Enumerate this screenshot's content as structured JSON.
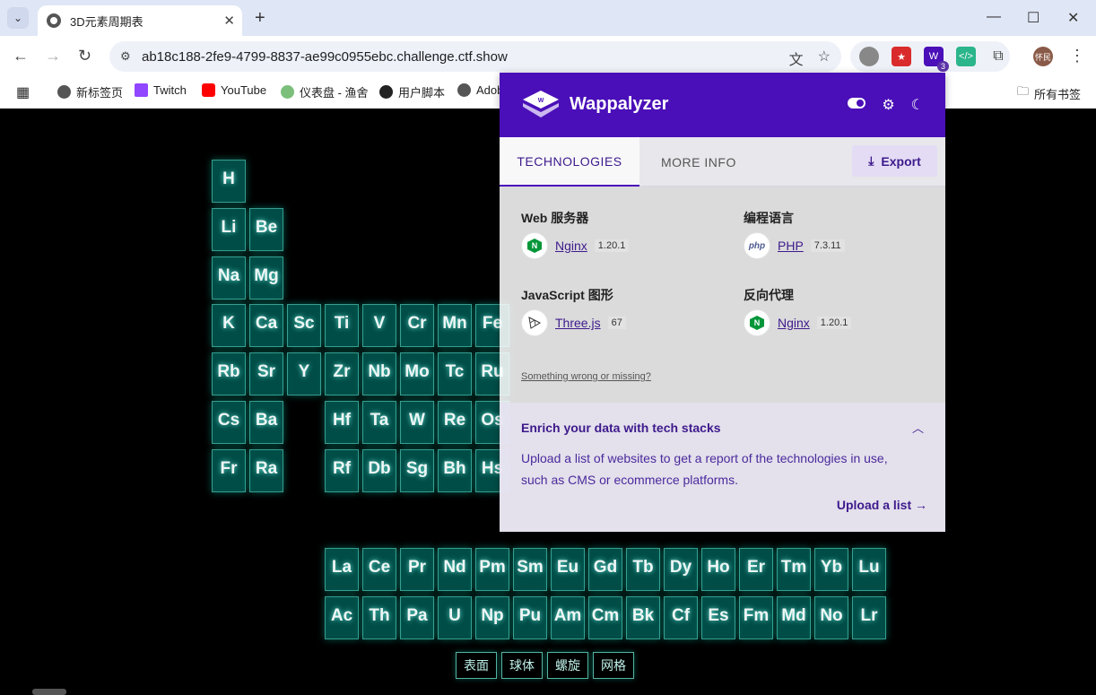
{
  "browser": {
    "tab_title": "3D元素周期表",
    "url": "ab18c188-2fe9-4799-8837-ae99c0955ebc.challenge.ctf.show",
    "ext_badge": "3",
    "avatar_text": "怀民"
  },
  "bookmarks": [
    {
      "label": "新标签页",
      "icon": "globe-icon",
      "color": "#555555"
    },
    {
      "label": "Twitch",
      "icon": "twitch-icon",
      "color": "#9146ff"
    },
    {
      "label": "YouTube",
      "icon": "youtube-icon",
      "color": "#ff0000"
    },
    {
      "label": "仪表盘 - 渔舍",
      "icon": "dashboard-icon",
      "color": "#7bbf7b"
    },
    {
      "label": "用户脚本",
      "icon": "script-icon",
      "color": "#222222"
    },
    {
      "label": "Adobe Ac...",
      "icon": "globe-icon",
      "color": "#555555"
    }
  ],
  "bookmarks_all": "所有书签",
  "table": {
    "elements": [
      {
        "s": "H",
        "r": 1,
        "c": 1
      },
      {
        "s": "Li",
        "r": 2,
        "c": 1
      },
      {
        "s": "Be",
        "r": 2,
        "c": 2
      },
      {
        "s": "Na",
        "r": 3,
        "c": 1
      },
      {
        "s": "Mg",
        "r": 3,
        "c": 2
      },
      {
        "s": "K",
        "r": 4,
        "c": 1
      },
      {
        "s": "Ca",
        "r": 4,
        "c": 2
      },
      {
        "s": "Sc",
        "r": 4,
        "c": 3
      },
      {
        "s": "Ti",
        "r": 4,
        "c": 4
      },
      {
        "s": "V",
        "r": 4,
        "c": 5
      },
      {
        "s": "Cr",
        "r": 4,
        "c": 6
      },
      {
        "s": "Mn",
        "r": 4,
        "c": 7
      },
      {
        "s": "Fe",
        "r": 4,
        "c": 8
      },
      {
        "s": "Rb",
        "r": 5,
        "c": 1
      },
      {
        "s": "Sr",
        "r": 5,
        "c": 2
      },
      {
        "s": "Y",
        "r": 5,
        "c": 3
      },
      {
        "s": "Zr",
        "r": 5,
        "c": 4
      },
      {
        "s": "Nb",
        "r": 5,
        "c": 5
      },
      {
        "s": "Mo",
        "r": 5,
        "c": 6
      },
      {
        "s": "Tc",
        "r": 5,
        "c": 7
      },
      {
        "s": "Ru",
        "r": 5,
        "c": 8
      },
      {
        "s": "Cs",
        "r": 6,
        "c": 1
      },
      {
        "s": "Ba",
        "r": 6,
        "c": 2
      },
      {
        "s": "Hf",
        "r": 6,
        "c": 4
      },
      {
        "s": "Ta",
        "r": 6,
        "c": 5
      },
      {
        "s": "W",
        "r": 6,
        "c": 6
      },
      {
        "s": "Re",
        "r": 6,
        "c": 7
      },
      {
        "s": "Os",
        "r": 6,
        "c": 8
      },
      {
        "s": "Fr",
        "r": 7,
        "c": 1
      },
      {
        "s": "Ra",
        "r": 7,
        "c": 2
      },
      {
        "s": "Rf",
        "r": 7,
        "c": 4
      },
      {
        "s": "Db",
        "r": 7,
        "c": 5
      },
      {
        "s": "Sg",
        "r": 7,
        "c": 6
      },
      {
        "s": "Bh",
        "r": 7,
        "c": 7
      },
      {
        "s": "Hs",
        "r": 7,
        "c": 8
      },
      {
        "s": "La",
        "r": 9,
        "c": 4
      },
      {
        "s": "Ce",
        "r": 9,
        "c": 5
      },
      {
        "s": "Pr",
        "r": 9,
        "c": 6
      },
      {
        "s": "Nd",
        "r": 9,
        "c": 7
      },
      {
        "s": "Pm",
        "r": 9,
        "c": 8
      },
      {
        "s": "Sm",
        "r": 9,
        "c": 9
      },
      {
        "s": "Eu",
        "r": 9,
        "c": 10
      },
      {
        "s": "Gd",
        "r": 9,
        "c": 11
      },
      {
        "s": "Tb",
        "r": 9,
        "c": 12
      },
      {
        "s": "Dy",
        "r": 9,
        "c": 13
      },
      {
        "s": "Ho",
        "r": 9,
        "c": 14
      },
      {
        "s": "Er",
        "r": 9,
        "c": 15
      },
      {
        "s": "Tm",
        "r": 9,
        "c": 16
      },
      {
        "s": "Yb",
        "r": 9,
        "c": 17
      },
      {
        "s": "Lu",
        "r": 9,
        "c": 18
      },
      {
        "s": "Ac",
        "r": 10,
        "c": 4
      },
      {
        "s": "Th",
        "r": 10,
        "c": 5
      },
      {
        "s": "Pa",
        "r": 10,
        "c": 6
      },
      {
        "s": "U",
        "r": 10,
        "c": 7
      },
      {
        "s": "Np",
        "r": 10,
        "c": 8
      },
      {
        "s": "Pu",
        "r": 10,
        "c": 9
      },
      {
        "s": "Am",
        "r": 10,
        "c": 10
      },
      {
        "s": "Cm",
        "r": 10,
        "c": 11
      },
      {
        "s": "Bk",
        "r": 10,
        "c": 12
      },
      {
        "s": "Cf",
        "r": 10,
        "c": 13
      },
      {
        "s": "Es",
        "r": 10,
        "c": 14
      },
      {
        "s": "Fm",
        "r": 10,
        "c": 15
      },
      {
        "s": "Md",
        "r": 10,
        "c": 16
      },
      {
        "s": "No",
        "r": 10,
        "c": 17
      },
      {
        "s": "Lr",
        "r": 10,
        "c": 18
      }
    ],
    "controls": [
      "表面",
      "球体",
      "螺旋",
      "网格"
    ]
  },
  "wappalyzer": {
    "name": "Wappalyzer",
    "tab_technologies": "TECHNOLOGIES",
    "tab_more_info": "MORE INFO",
    "export_label": "Export",
    "categories": [
      {
        "name": "Web 服务器",
        "tech": "Nginx",
        "version": "1.20.1",
        "icon": "nginx-icon"
      },
      {
        "name": "编程语言",
        "tech": "PHP",
        "version": "7.3.11",
        "icon": "php-icon"
      },
      {
        "name": "JavaScript 图形",
        "tech": "Three.js",
        "version": "67",
        "icon": "threejs-icon"
      },
      {
        "name": "反向代理",
        "tech": "Nginx",
        "version": "1.20.1",
        "icon": "nginx-icon"
      }
    ],
    "wrong_link": "Something wrong or missing?",
    "enrich_title": "Enrich your data with tech stacks",
    "enrich_text": "Upload a list of websites to get a report of the technologies in use, such as CMS or ecommerce platforms.",
    "upload_label": "Upload a list"
  }
}
